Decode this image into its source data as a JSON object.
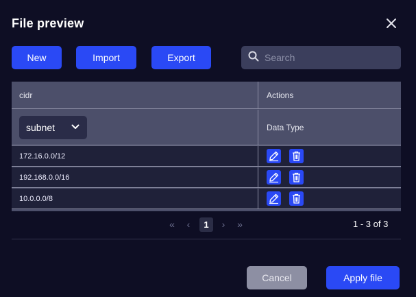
{
  "dialog": {
    "title": "File preview"
  },
  "toolbar": {
    "new_label": "New",
    "import_label": "Import",
    "export_label": "Export",
    "search_placeholder": "Search",
    "search_value": ""
  },
  "table": {
    "columns": [
      "cidr",
      "Actions"
    ],
    "filter": {
      "selected": "subnet",
      "icon": "chevron-down-icon"
    },
    "secondary_header": "Data Type",
    "rows": [
      {
        "cidr": "172.16.0.0/12"
      },
      {
        "cidr": "192.168.0.0/16"
      },
      {
        "cidr": "10.0.0.0/8"
      }
    ],
    "row_action_icons": [
      "pencil-icon",
      "trash-icon"
    ]
  },
  "pagination": {
    "current_page": "1",
    "range_text": "1 - 3 of 3",
    "icons": [
      "first-page-icon",
      "prev-page-icon",
      "next-page-icon",
      "last-page-icon"
    ]
  },
  "footer": {
    "cancel_label": "Cancel",
    "apply_label": "Apply file"
  },
  "colors": {
    "background": "#0e0e24",
    "accent": "#2a49f5",
    "table_header": "#4c4f6a",
    "row": "#1f2139",
    "cancel": "#8d8fa3"
  }
}
